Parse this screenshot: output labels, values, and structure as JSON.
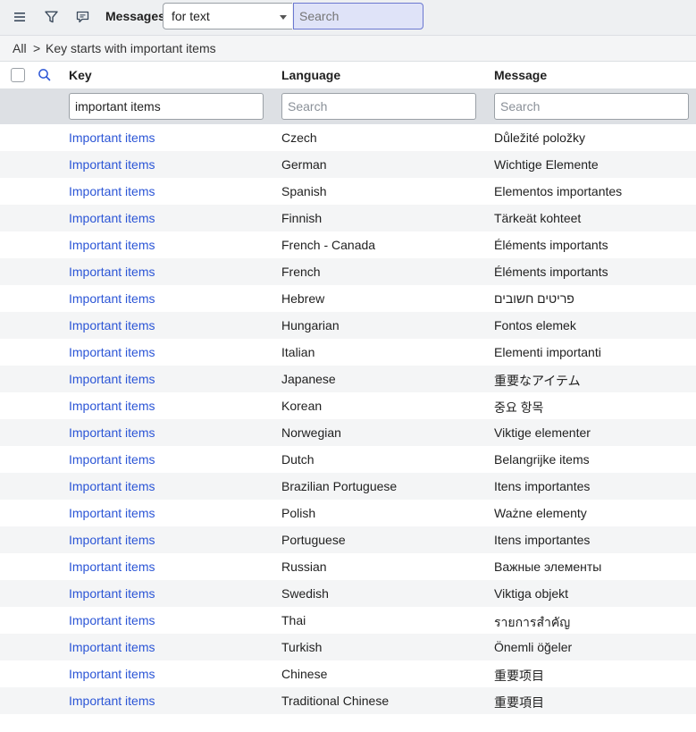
{
  "toolbar": {
    "title": "Messages",
    "select_value": "for text",
    "search_placeholder": "Search",
    "icons": [
      "menu-icon",
      "filter-icon",
      "comment-icon"
    ]
  },
  "breadcrumb": {
    "root": "All",
    "separator": ">",
    "current": "Key starts with important items"
  },
  "table": {
    "columns": [
      "Key",
      "Language",
      "Message"
    ],
    "filters": {
      "key_value": "important items",
      "language_placeholder": "Search",
      "message_placeholder": "Search"
    },
    "rows": [
      {
        "key": "Important items",
        "language": "Czech",
        "message": "Důležité položky"
      },
      {
        "key": "Important items",
        "language": "German",
        "message": "Wichtige Elemente"
      },
      {
        "key": "Important items",
        "language": "Spanish",
        "message": "Elementos importantes"
      },
      {
        "key": "Important items",
        "language": "Finnish",
        "message": "Tärkeät kohteet"
      },
      {
        "key": "Important items",
        "language": "French - Canada",
        "message": "Éléments importants"
      },
      {
        "key": "Important items",
        "language": "French",
        "message": "Éléments importants"
      },
      {
        "key": "Important items",
        "language": "Hebrew",
        "message": "פריטים חשובים"
      },
      {
        "key": "Important items",
        "language": "Hungarian",
        "message": "Fontos elemek"
      },
      {
        "key": "Important items",
        "language": "Italian",
        "message": "Elementi importanti"
      },
      {
        "key": "Important items",
        "language": "Japanese",
        "message": "重要なアイテム"
      },
      {
        "key": "Important items",
        "language": "Korean",
        "message": "중요 항목"
      },
      {
        "key": "Important items",
        "language": "Norwegian",
        "message": "Viktige elementer"
      },
      {
        "key": "Important items",
        "language": "Dutch",
        "message": "Belangrijke items"
      },
      {
        "key": "Important items",
        "language": "Brazilian Portuguese",
        "message": "Itens importantes"
      },
      {
        "key": "Important items",
        "language": "Polish",
        "message": "Ważne elementy"
      },
      {
        "key": "Important items",
        "language": "Portuguese",
        "message": "Itens importantes"
      },
      {
        "key": "Important items",
        "language": "Russian",
        "message": "Важные элементы"
      },
      {
        "key": "Important items",
        "language": "Swedish",
        "message": "Viktiga objekt"
      },
      {
        "key": "Important items",
        "language": "Thai",
        "message": "รายการสำคัญ"
      },
      {
        "key": "Important items",
        "language": "Turkish",
        "message": "Önemli öğeler"
      },
      {
        "key": "Important items",
        "language": "Chinese",
        "message": "重要项目"
      },
      {
        "key": "Important items",
        "language": "Traditional Chinese",
        "message": "重要項目"
      }
    ]
  },
  "colors": {
    "link": "#2b55d6",
    "toolbar_bg": "#eef0f2",
    "filter_row_bg": "#dde0e4",
    "alt_row_bg": "#f4f5f6",
    "search_active_bg": "#dfe3f8"
  }
}
